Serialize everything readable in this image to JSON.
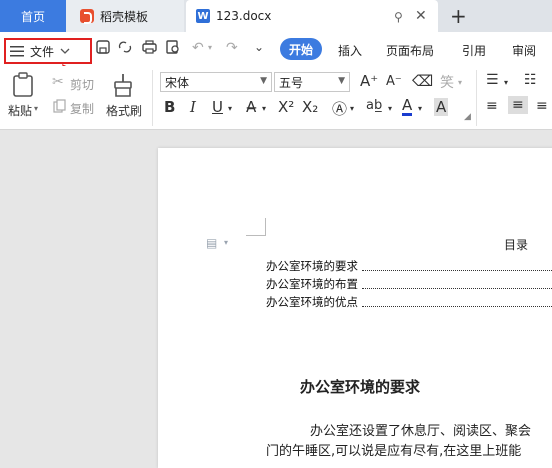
{
  "tabs": {
    "home": "首页",
    "daoke": "稻壳模板",
    "doc": "123.docx",
    "doc_logo": "W"
  },
  "menu": {
    "file": "文件",
    "ribbon_tabs": [
      "开始",
      "插入",
      "页面布局",
      "引用",
      "审阅"
    ]
  },
  "toolbar": {
    "paste": "粘贴",
    "cut": "剪切",
    "copy": "复制",
    "format_painter": "格式刷",
    "font": "宋体",
    "font_size": "五号"
  },
  "document": {
    "toc_title": "目录",
    "toc_items": [
      "办公室环境的要求",
      "办公室环境的布置",
      "办公室环境的优点"
    ],
    "heading": "办公室环境的要求",
    "body_line1": "办公室还设置了休息厅、阅读区、聚会",
    "body_line2": "门的午睡区,可以说是应有尽有,在这里上班能"
  },
  "colors": {
    "accent": "#3c7be0",
    "highlight_box": "#e02020",
    "font_color": "#1a3ccf"
  },
  "icons": [
    "hamburger-icon",
    "chevron-down-icon",
    "save-icon",
    "print-icon",
    "undo-icon",
    "redo-icon",
    "paste-icon",
    "cut-icon",
    "copy-icon",
    "format-painter-icon",
    "bold-icon",
    "italic-icon",
    "underline-icon",
    "font-color-icon",
    "align-center-icon"
  ]
}
